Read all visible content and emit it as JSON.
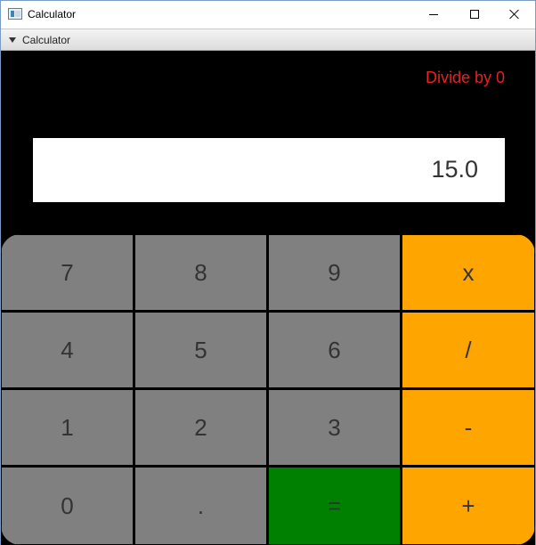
{
  "window": {
    "title": "Calculator",
    "pane_title": "Calculator"
  },
  "calculator": {
    "error_message": "Divide by 0",
    "display_value": "15.0",
    "keys": [
      {
        "label": "7",
        "role": "digit"
      },
      {
        "label": "8",
        "role": "digit"
      },
      {
        "label": "9",
        "role": "digit"
      },
      {
        "label": "x",
        "role": "operator"
      },
      {
        "label": "4",
        "role": "digit"
      },
      {
        "label": "5",
        "role": "digit"
      },
      {
        "label": "6",
        "role": "digit"
      },
      {
        "label": "/",
        "role": "operator"
      },
      {
        "label": "1",
        "role": "digit"
      },
      {
        "label": "2",
        "role": "digit"
      },
      {
        "label": "3",
        "role": "digit"
      },
      {
        "label": "-",
        "role": "operator"
      },
      {
        "label": "0",
        "role": "digit"
      },
      {
        "label": ".",
        "role": "digit"
      },
      {
        "label": "=",
        "role": "equals"
      },
      {
        "label": "+",
        "role": "operator"
      }
    ]
  },
  "colors": {
    "error": "#e8201f",
    "digit_key": "#808080",
    "operator_key": "#ffa500",
    "equals_key": "#008000",
    "background": "#000000"
  }
}
